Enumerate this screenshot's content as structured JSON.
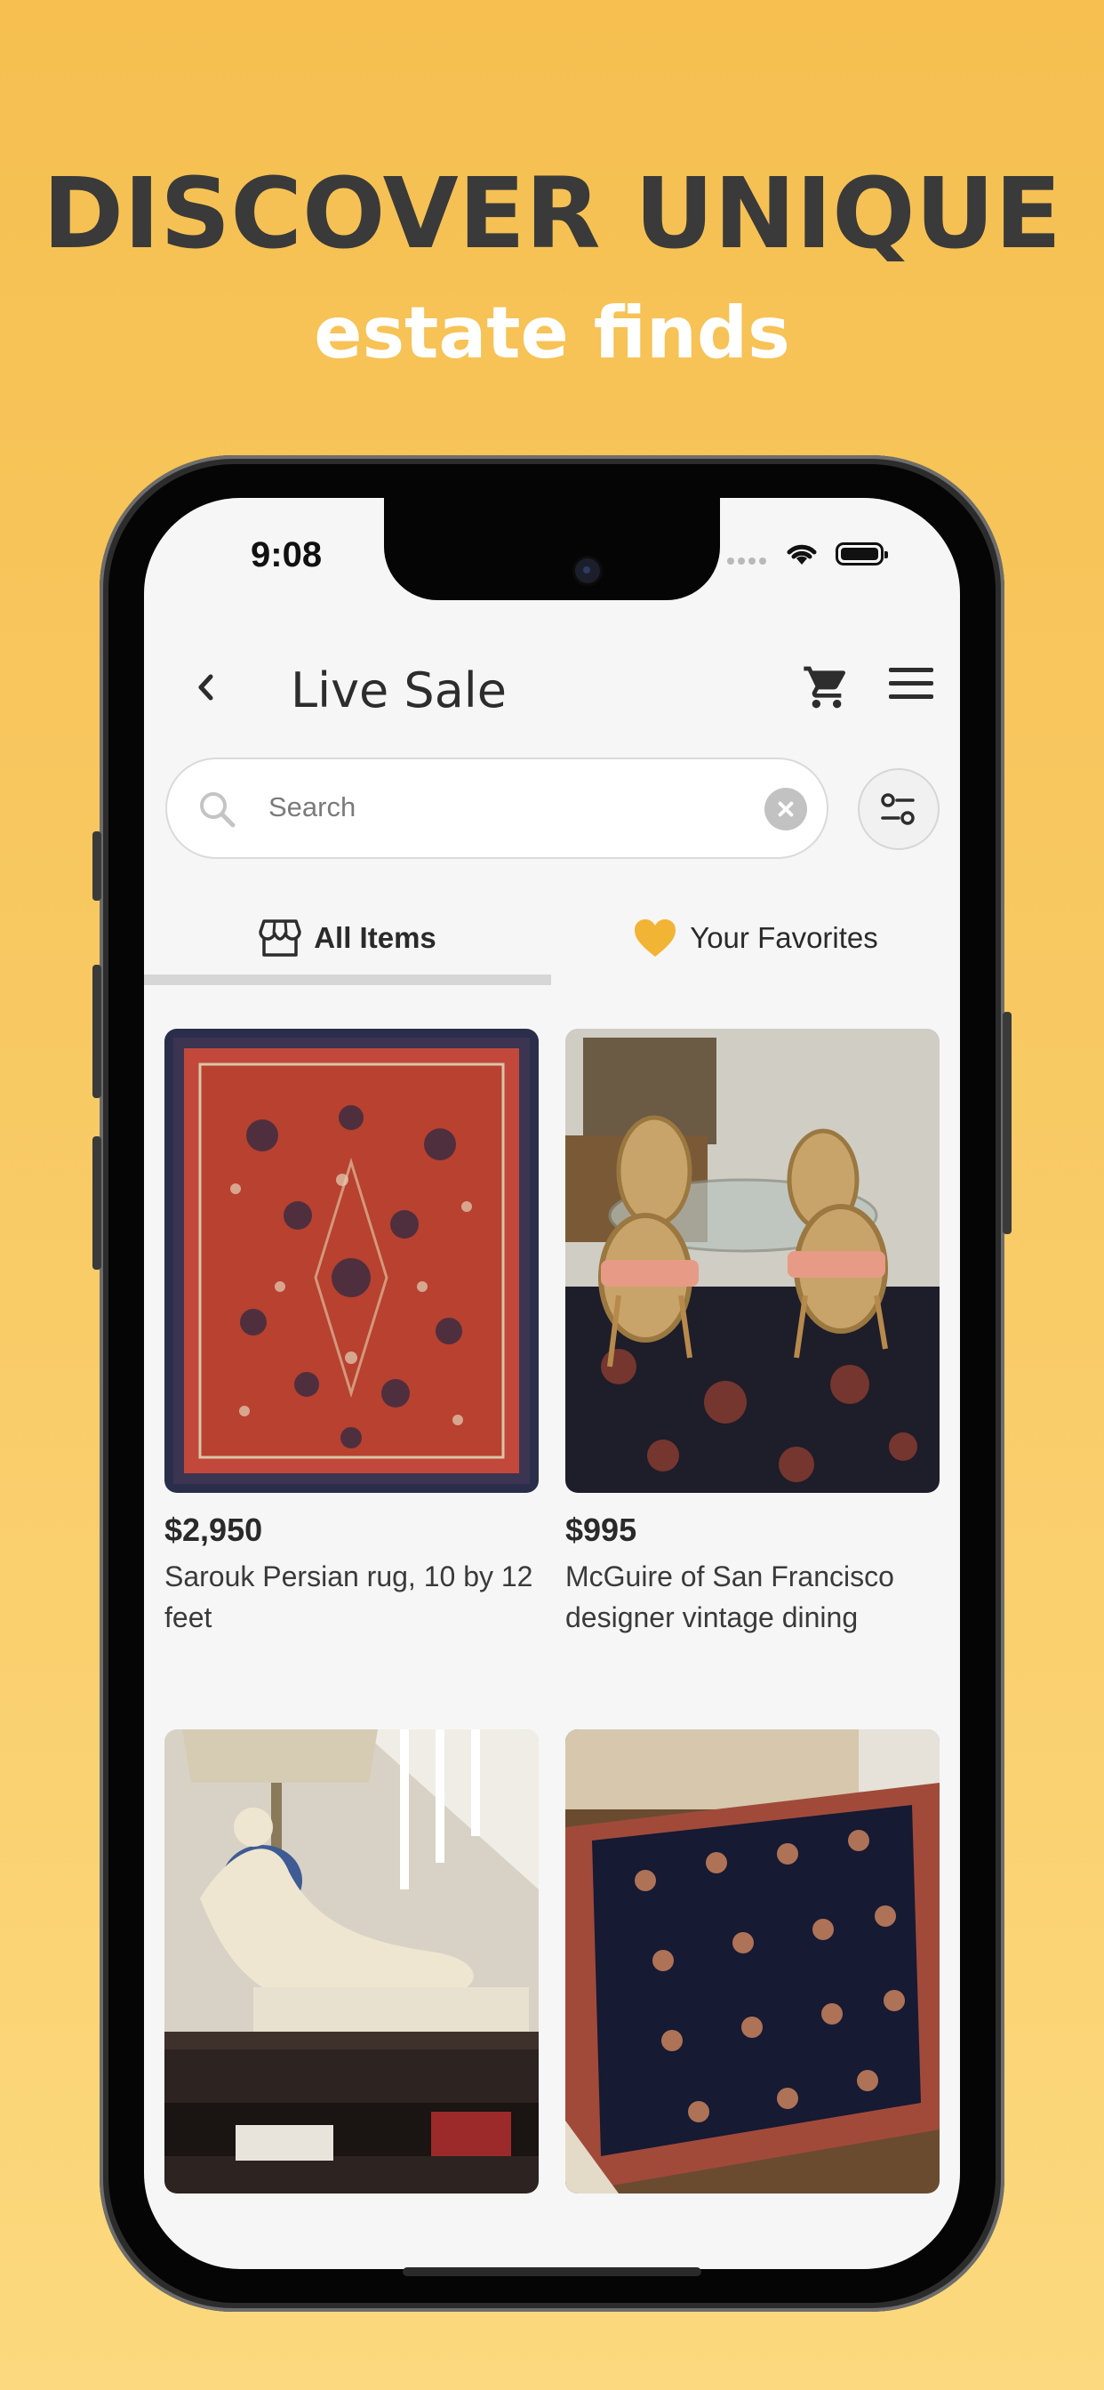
{
  "promo": {
    "headline": "DISCOVER UNIQUE",
    "subline": "estate finds"
  },
  "status_bar": {
    "time": "9:08"
  },
  "nav": {
    "title": "Live Sale",
    "back_icon": "chevron-left-icon",
    "cart_icon": "cart-icon",
    "menu_icon": "hamburger-menu-icon"
  },
  "search": {
    "placeholder": "Search",
    "value": ""
  },
  "tabs": [
    {
      "label": "All Items",
      "icon": "storefront-icon",
      "selected": true
    },
    {
      "label": "Your Favorites",
      "icon": "heart-icon",
      "selected": false
    }
  ],
  "items": [
    {
      "price": "$2,950",
      "title": "Sarouk Persian rug, 10 by 12 feet",
      "image": "red persian rug"
    },
    {
      "price": "$995",
      "title": "McGuire of San Francisco designer vintage dining",
      "image": "glass dining table with rattan chairs"
    },
    {
      "price": "",
      "title": "",
      "image": "marble statue of reclining woman"
    },
    {
      "price": "",
      "title": "",
      "image": "navy floral area rug"
    }
  ],
  "colors": {
    "background": "#F6BF50",
    "accent": "#F2B434",
    "text": "#2a2a2a"
  }
}
